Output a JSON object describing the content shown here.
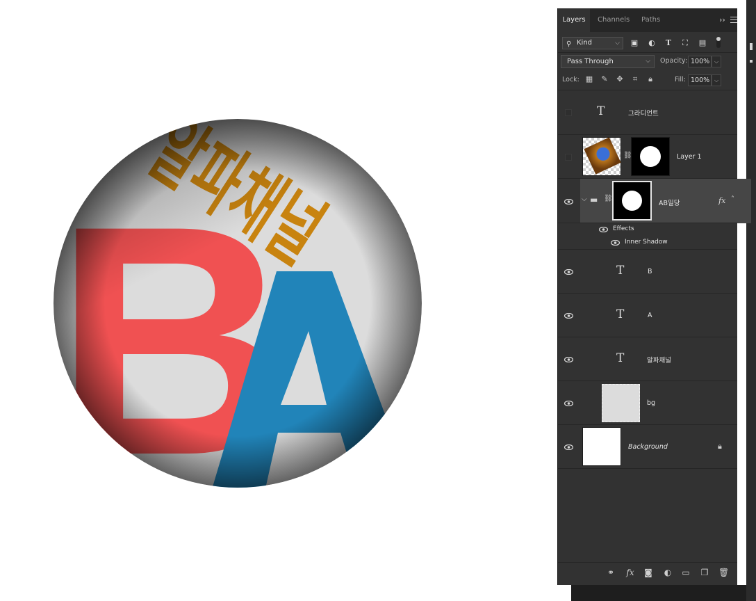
{
  "panel": {
    "tabs": [
      {
        "label": "Layers",
        "active": true
      },
      {
        "label": "Channels",
        "active": false
      },
      {
        "label": "Paths",
        "active": false
      }
    ],
    "collapse_glyph": "››",
    "filter": {
      "kind_label": "Kind",
      "filter_icons": [
        "image-filter-icon",
        "adjustment-filter-icon",
        "type-filter-icon",
        "shape-filter-icon",
        "smart-object-filter-icon"
      ]
    },
    "blend_mode": "Pass Through",
    "opacity_label": "Opacity:",
    "opacity_value": "100%",
    "lock_label": "Lock:",
    "fill_label": "Fill:",
    "fill_value": "100%",
    "layers": [
      {
        "name": "그라디언트",
        "type": "text",
        "visible": false
      },
      {
        "name": "Layer 1",
        "type": "pixel-with-mask",
        "visible": false
      },
      {
        "name": "AB일당",
        "type": "group-with-mask",
        "visible": true,
        "selected": true,
        "fx": "fx",
        "effects_label": "Effects",
        "effects": [
          "Inner Shadow"
        ]
      },
      {
        "name": "B",
        "type": "text",
        "visible": true
      },
      {
        "name": "A",
        "type": "text",
        "visible": true
      },
      {
        "name": "알파채널",
        "type": "text",
        "visible": true
      },
      {
        "name": "bg",
        "type": "pixel",
        "visible": true
      },
      {
        "name": "Background",
        "type": "background",
        "visible": true,
        "locked": true
      }
    ],
    "type_glyph": "T",
    "footer_icons": [
      "link-layers-icon",
      "fx-icon",
      "add-mask-icon",
      "adjustment-layer-icon",
      "new-group-icon",
      "new-layer-icon",
      "delete-layer-icon"
    ]
  },
  "artwork": {
    "korean_text": "알파채널",
    "letter_b": "B",
    "letter_a": "A",
    "colors": {
      "circle_bg": "#dcdcdc",
      "b_red": "#f05152",
      "a_blue": "#2184b9",
      "korean_gold": "#c8830f",
      "shadow": "#7d7d7d"
    }
  }
}
